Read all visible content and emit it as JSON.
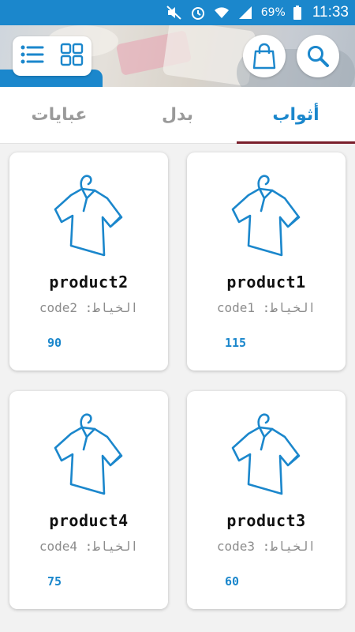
{
  "status_bar": {
    "battery": "69%",
    "time": "11:33"
  },
  "header": {
    "grid_view_icon": "grid-icon",
    "list_view_icon": "list-icon",
    "cart_icon": "shopping-bag-icon",
    "search_icon": "search-icon"
  },
  "tabs": [
    {
      "label": "أثواب",
      "active": true
    },
    {
      "label": "بدل",
      "active": false
    },
    {
      "label": "عبايات",
      "active": false
    }
  ],
  "products": [
    {
      "name": "product1",
      "code": "الخياط: code1",
      "price": "115"
    },
    {
      "name": "product2",
      "code": "الخياط: code2",
      "price": "90"
    },
    {
      "name": "product3",
      "code": "الخياط: code3",
      "price": "60"
    },
    {
      "name": "product4",
      "code": "الخياط: code4",
      "price": "75"
    }
  ],
  "colors": {
    "accent": "#1b87cc",
    "tab_indicator": "#7a1e2b"
  }
}
